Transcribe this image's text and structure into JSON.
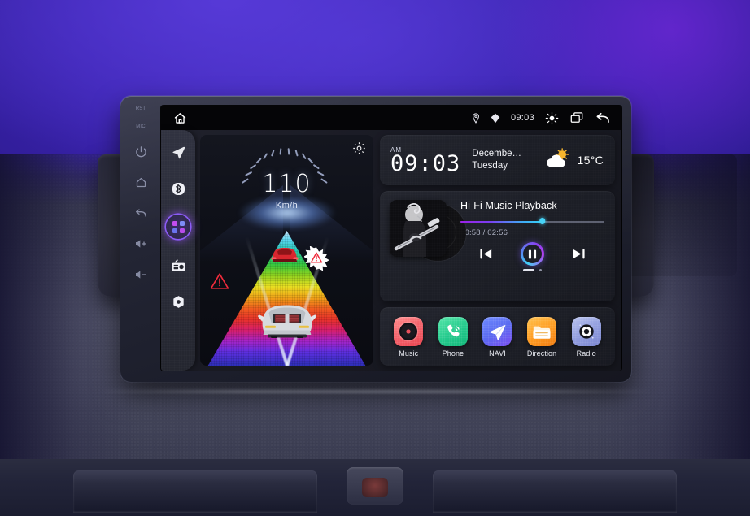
{
  "device": {
    "hardware_buttons": [
      {
        "name": "reset-label",
        "label": "RST"
      },
      {
        "name": "mic-label",
        "label": "MIC"
      },
      {
        "name": "power-button",
        "icon": "power-icon"
      },
      {
        "name": "home-button",
        "icon": "home-icon"
      },
      {
        "name": "back-button",
        "icon": "back-arrow-icon"
      },
      {
        "name": "volume-up-button",
        "icon": "volume-up-icon"
      },
      {
        "name": "volume-down-button",
        "icon": "volume-down-icon"
      }
    ]
  },
  "statusbar": {
    "home_icon": "home-icon",
    "location_icon": "location-pin-icon",
    "bluetooth_icon": "bluetooth-diamond-icon",
    "time": "09:03",
    "brightness_icon": "brightness-icon",
    "recents_icon": "recent-apps-icon",
    "back_icon": "back-arrow-icon"
  },
  "rail": {
    "items": [
      {
        "name": "sidebar-item-navigation",
        "icon": "navigation-arrow-icon",
        "active": false
      },
      {
        "name": "sidebar-item-bluetooth",
        "icon": "bluetooth-icon",
        "active": false
      },
      {
        "name": "sidebar-item-apps",
        "icon": "apps-grid-icon",
        "active": true
      },
      {
        "name": "sidebar-item-radio",
        "icon": "radio-icon",
        "active": false
      },
      {
        "name": "sidebar-item-settings",
        "icon": "settings-icon",
        "active": false
      }
    ]
  },
  "hud": {
    "speed": "110",
    "unit": "Km/h",
    "gear_icon": "gear-icon",
    "warning_icon": "warning-triangle-icon",
    "collision_icon": "collision-burst-icon",
    "ego_vehicle": "white-car",
    "lead_vehicle": "red-car"
  },
  "clock": {
    "meridiem": "AM",
    "time": "09:03",
    "date": "Decembe…",
    "weekday": "Tuesday",
    "weather_icon": "partly-cloudy-icon",
    "temperature": "15°C"
  },
  "music": {
    "title": "Hi-Fi Music Playback",
    "elapsed": "00:58",
    "duration": "02:56",
    "time_display": "00:58 / 02:56",
    "progress_percent": 57,
    "album_art": "guitarist-photo",
    "prev_icon": "previous-track-icon",
    "play_icon": "pause-icon",
    "next_icon": "next-track-icon",
    "page_indicator": [
      "active",
      "inactive"
    ]
  },
  "apps": [
    {
      "name": "app-music",
      "label": "Music",
      "icon": "vinyl-record-icon",
      "class": "ico-music"
    },
    {
      "name": "app-phone",
      "label": "Phone",
      "icon": "phone-handset-icon",
      "class": "ico-phone"
    },
    {
      "name": "app-navi",
      "label": "NAVI",
      "icon": "paper-plane-icon",
      "class": "ico-navi"
    },
    {
      "name": "app-direction",
      "label": "Direction",
      "icon": "folder-icon",
      "class": "ico-dir"
    },
    {
      "name": "app-radio",
      "label": "Radio",
      "icon": "radio-dial-icon",
      "class": "ico-radio"
    }
  ],
  "colors": {
    "accent_purple": "#8b5cf6",
    "accent_cyan": "#46d4f8",
    "background_purple": "#3b24b0",
    "screen_dark": "#15161d"
  }
}
